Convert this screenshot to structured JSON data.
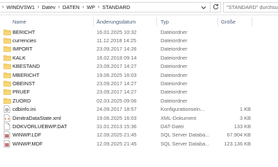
{
  "breadcrumb": [
    "WINDVSW1",
    "Datev",
    "DATEN",
    "WP",
    "STANDARD"
  ],
  "search": {
    "placeholder": "\"STANDARD\" durchsu"
  },
  "columns": {
    "name": "Name",
    "date": "Änderungsdatum",
    "type": "Typ",
    "size": "Größe"
  },
  "files": [
    {
      "icon": "folder-icon",
      "name": "BERICHT",
      "date": "16.01.2025 10:32",
      "type": "Dateiordner",
      "size": ""
    },
    {
      "icon": "folder-icon",
      "name": "currencies",
      "date": "11.12.2018 14:25",
      "type": "Dateiordner",
      "size": ""
    },
    {
      "icon": "folder-icon",
      "name": "IMPORT",
      "date": "23.09.2017 14:26",
      "type": "Dateiordner",
      "size": ""
    },
    {
      "icon": "folder-icon",
      "name": "KALK",
      "date": "16.02.2018 09:14",
      "type": "Dateiordner",
      "size": ""
    },
    {
      "icon": "folder-icon",
      "name": "KBESTAND",
      "date": "23.09.2017 14:27",
      "type": "Dateiordner",
      "size": ""
    },
    {
      "icon": "folder-icon",
      "name": "MBERICHT",
      "date": "19.06.2025 16:03",
      "type": "Dateiordner",
      "size": ""
    },
    {
      "icon": "folder-icon",
      "name": "OBEINST",
      "date": "23.09.2017 14:27",
      "type": "Dateiordner",
      "size": ""
    },
    {
      "icon": "folder-icon",
      "name": "PRUEF",
      "date": "23.09.2017 14:27",
      "type": "Dateiordner",
      "size": ""
    },
    {
      "icon": "folder-icon",
      "name": "ZUORD",
      "date": "02.03.2025 09:06",
      "type": "Dateiordner",
      "size": ""
    },
    {
      "icon": "settings-file-icon",
      "name": "cdbinfo.ini",
      "date": "24.09.2017 18:57",
      "type": "Konfigurationsein...",
      "size": "1 KB"
    },
    {
      "icon": "xml-file-icon",
      "name": "DimitraDataState.xml",
      "date": "19.06.2025 16:03",
      "type": "XML-Dokument",
      "size": "3 KB"
    },
    {
      "icon": "file-icon",
      "name": "DOKVORLUEBWP.DAT",
      "date": "31.01.2013 15:36",
      "type": "DAT-Datei",
      "size": "133 KB"
    },
    {
      "icon": "database-file-icon",
      "name": "WINWP.LDF",
      "date": "12.09.2025 21:45",
      "type": "SQL Server Databa...",
      "size": "67.904 KB"
    },
    {
      "icon": "database-file-icon",
      "name": "WINWP.MDF",
      "date": "12.09.2025 21:45",
      "type": "SQL Server Databa...",
      "size": "123.136 KB"
    }
  ]
}
